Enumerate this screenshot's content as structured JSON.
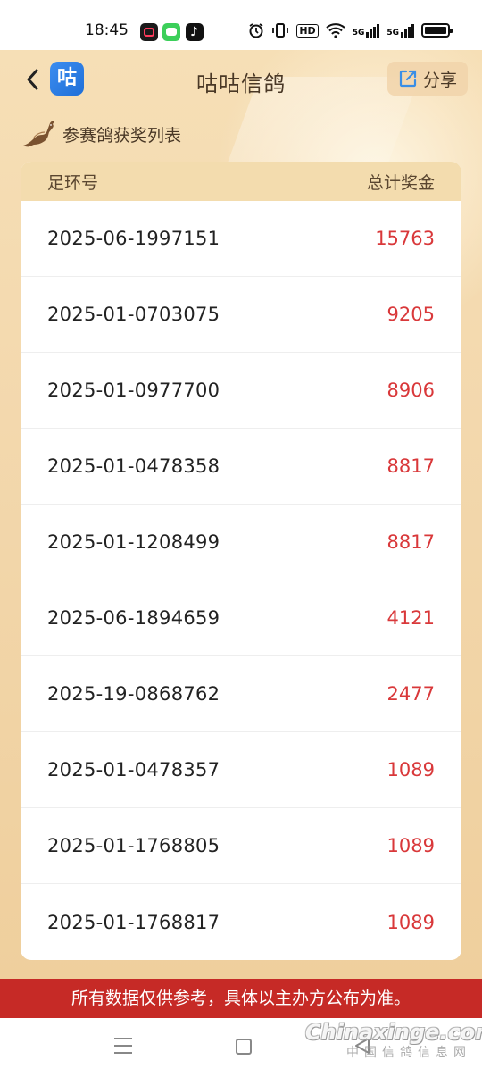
{
  "status_bar": {
    "time": "18:45",
    "signal_label_1": "5G",
    "signal_label_2": "5G",
    "hd_label": "HD"
  },
  "header": {
    "title": "咕咕信鸽",
    "logo_text": "咕",
    "share_label": "分享",
    "accent_color": "#2b7fe6"
  },
  "section": {
    "title": "参赛鸽获奖列表"
  },
  "table": {
    "columns": [
      "足环号",
      "总计奖金"
    ],
    "rows": [
      {
        "ring": "2025-06-1997151",
        "prize": "15763"
      },
      {
        "ring": "2025-01-0703075",
        "prize": "9205"
      },
      {
        "ring": "2025-01-0977700",
        "prize": "8906"
      },
      {
        "ring": "2025-01-0478358",
        "prize": "8817"
      },
      {
        "ring": "2025-01-1208499",
        "prize": "8817"
      },
      {
        "ring": "2025-06-1894659",
        "prize": "4121"
      },
      {
        "ring": "2025-19-0868762",
        "prize": "2477"
      },
      {
        "ring": "2025-01-0478357",
        "prize": "1089"
      },
      {
        "ring": "2025-01-1768805",
        "prize": "1089"
      },
      {
        "ring": "2025-01-1768817",
        "prize": "1089"
      }
    ],
    "prize_color": "#d9383a"
  },
  "footer": {
    "notice": "所有数据仅供参考，具体以主办方公布为准。",
    "banner_color": "#c62a26"
  },
  "watermark": {
    "main": "Chinaxinge.com",
    "sub": "中国信鸽信息网"
  }
}
